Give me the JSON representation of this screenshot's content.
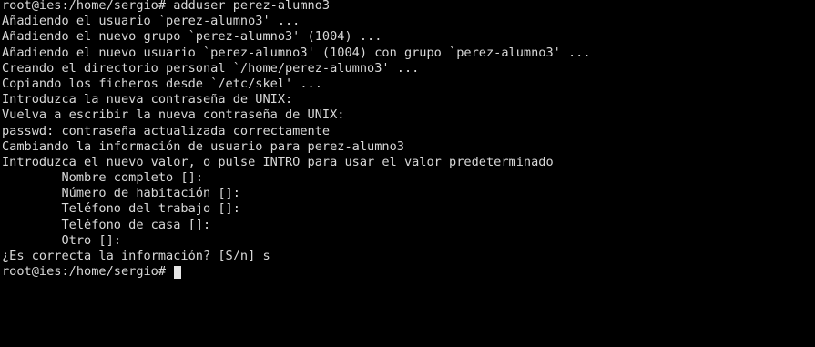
{
  "terminal": {
    "lines": [
      "root@ies:/home/sergio# adduser perez-alumno3",
      "Añadiendo el usuario `perez-alumno3' ...",
      "Añadiendo el nuevo grupo `perez-alumno3' (1004) ...",
      "Añadiendo el nuevo usuario `perez-alumno3' (1004) con grupo `perez-alumno3' ...",
      "Creando el directorio personal `/home/perez-alumno3' ...",
      "Copiando los ficheros desde `/etc/skel' ...",
      "Introduzca la nueva contraseña de UNIX:",
      "Vuelva a escribir la nueva contraseña de UNIX:",
      "passwd: contraseña actualizada correctamente",
      "Cambiando la información de usuario para perez-alumno3",
      "Introduzca el nuevo valor, o pulse INTRO para usar el valor predeterminado",
      "        Nombre completo []:",
      "        Número de habitación []:",
      "        Teléfono del trabajo []:",
      "        Teléfono de casa []:",
      "        Otro []:",
      "¿Es correcta la información? [S/n] s"
    ],
    "current_prompt": "root@ies:/home/sergio# "
  }
}
